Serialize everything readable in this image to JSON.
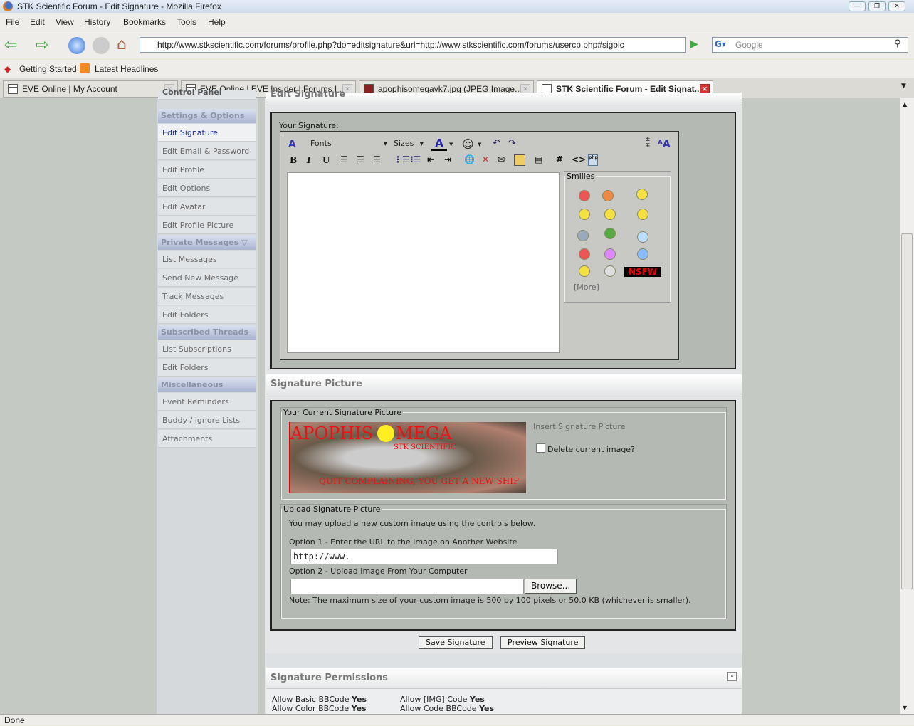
{
  "window": {
    "title": "STK Scientific Forum - Edit Signature - Mozilla Firefox"
  },
  "menu": [
    "File",
    "Edit",
    "View",
    "History",
    "Bookmarks",
    "Tools",
    "Help"
  ],
  "nav": {
    "url": "http://www.stkscientific.com/forums/profile.php?do=editsignature&url=http://www.stkscientific.com/forums/usercp.php#sigpic",
    "search_placeholder": "Google"
  },
  "bookmarks": [
    "Getting Started",
    "Latest Headlines"
  ],
  "tabs": [
    "EVE Online | My Account",
    "EVE Online | EVE Insider | Forums | ...",
    "apophisomegavk7.jpg (JPEG Image...",
    "STK Scientific Forum - Edit Signat..."
  ],
  "sidebar": {
    "cut_title": "Control Panel",
    "sections": [
      {
        "title": "Settings & Options",
        "items": [
          "Edit Signature",
          "Edit Email & Password",
          "Edit Profile",
          "Edit Options",
          "Edit Avatar",
          "Edit Profile Picture"
        ]
      },
      {
        "title": "Private Messages",
        "items": [
          "List Messages",
          "Send New Message",
          "Track Messages",
          "Edit Folders"
        ]
      },
      {
        "title": "Subscribed Threads",
        "items": [
          "List Subscriptions",
          "Edit Folders"
        ]
      },
      {
        "title": "Miscellaneous",
        "items": [
          "Event Reminders",
          "Buddy / Ignore Lists",
          "Attachments"
        ]
      }
    ]
  },
  "editor": {
    "cut_title": "Edit Signature",
    "label": "Your Signature:",
    "fonts": "Fonts",
    "sizes": "Sizes",
    "bold": "B",
    "italic": "I",
    "underline": "U",
    "smilies_title": "Smilies",
    "nsfw": "NSFW",
    "more": "[More]",
    "hash": "#",
    "code": "<>"
  },
  "sigpic": {
    "title": "Signature Picture",
    "current_legend": "Your Current Signature Picture",
    "image_text": [
      "APOPHIS",
      "MEGA",
      "STK SCIENTIFIC",
      "QUIT COMPLAINING, YOU GET A NEW SHIP"
    ],
    "insert": "Insert Signature Picture",
    "delete": "Delete current image?",
    "upload_legend": "Upload Signature Picture",
    "upload_desc": "You may upload a new custom image using the controls below.",
    "option1": "Option 1 - Enter the URL to the Image on Another Website",
    "url_value": "http://www.",
    "option2": "Option 2 - Upload Image From Your Computer",
    "browse": "Browse...",
    "note": "Note: The maximum size of your custom image is 500 by 100 pixels or 50.0 KB (whichever is smaller)."
  },
  "buttons": {
    "save": "Save Signature",
    "preview": "Preview Signature"
  },
  "permissions": {
    "title": "Signature Permissions",
    "items": [
      {
        "label": "Allow Basic BBCode",
        "value": "Yes"
      },
      {
        "label": "Allow [IMG] Code",
        "value": "Yes"
      },
      {
        "label": "Allow Color BBCode",
        "value": "Yes"
      },
      {
        "label": "Allow Code BBCode",
        "value": "Yes"
      }
    ]
  },
  "status": "Done"
}
